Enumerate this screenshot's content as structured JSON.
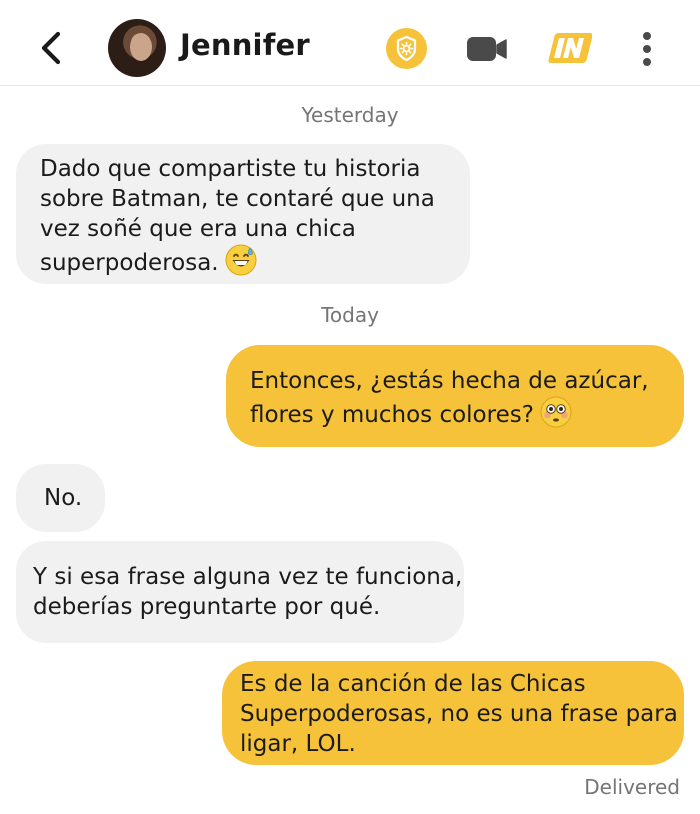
{
  "header": {
    "contact_name": "Jennifer",
    "icons": {
      "back": "chevron-left-icon",
      "badge": "sun-badge-icon",
      "video": "video-call-icon",
      "app_logo": "in-logo-icon",
      "menu": "more-vertical-icon"
    },
    "accent_color": "#f5c23a"
  },
  "conversation": {
    "date_yesterday": "Yesterday",
    "date_today": "Today",
    "messages": [
      {
        "direction": "incoming",
        "lines": [
          "Dado que compartiste tu historia",
          "sobre Batman, te contaré que una",
          "vez soñé que era una chica",
          "superpoderosa."
        ],
        "emoji": "😅"
      },
      {
        "direction": "outgoing",
        "lines": [
          "Entonces, ¿estás hecha de azúcar,",
          "flores y muchos colores?"
        ],
        "emoji": "😳"
      },
      {
        "direction": "incoming",
        "lines": [
          "No."
        ]
      },
      {
        "direction": "incoming",
        "lines": [
          "Y si esa frase alguna vez te funciona,",
          "deberías preguntarte por qué."
        ]
      },
      {
        "direction": "outgoing",
        "lines": [
          "Es de la canción de las Chicas",
          "Superpoderosas, no es una frase para",
          "ligar, LOL."
        ]
      }
    ],
    "status": "Delivered"
  }
}
